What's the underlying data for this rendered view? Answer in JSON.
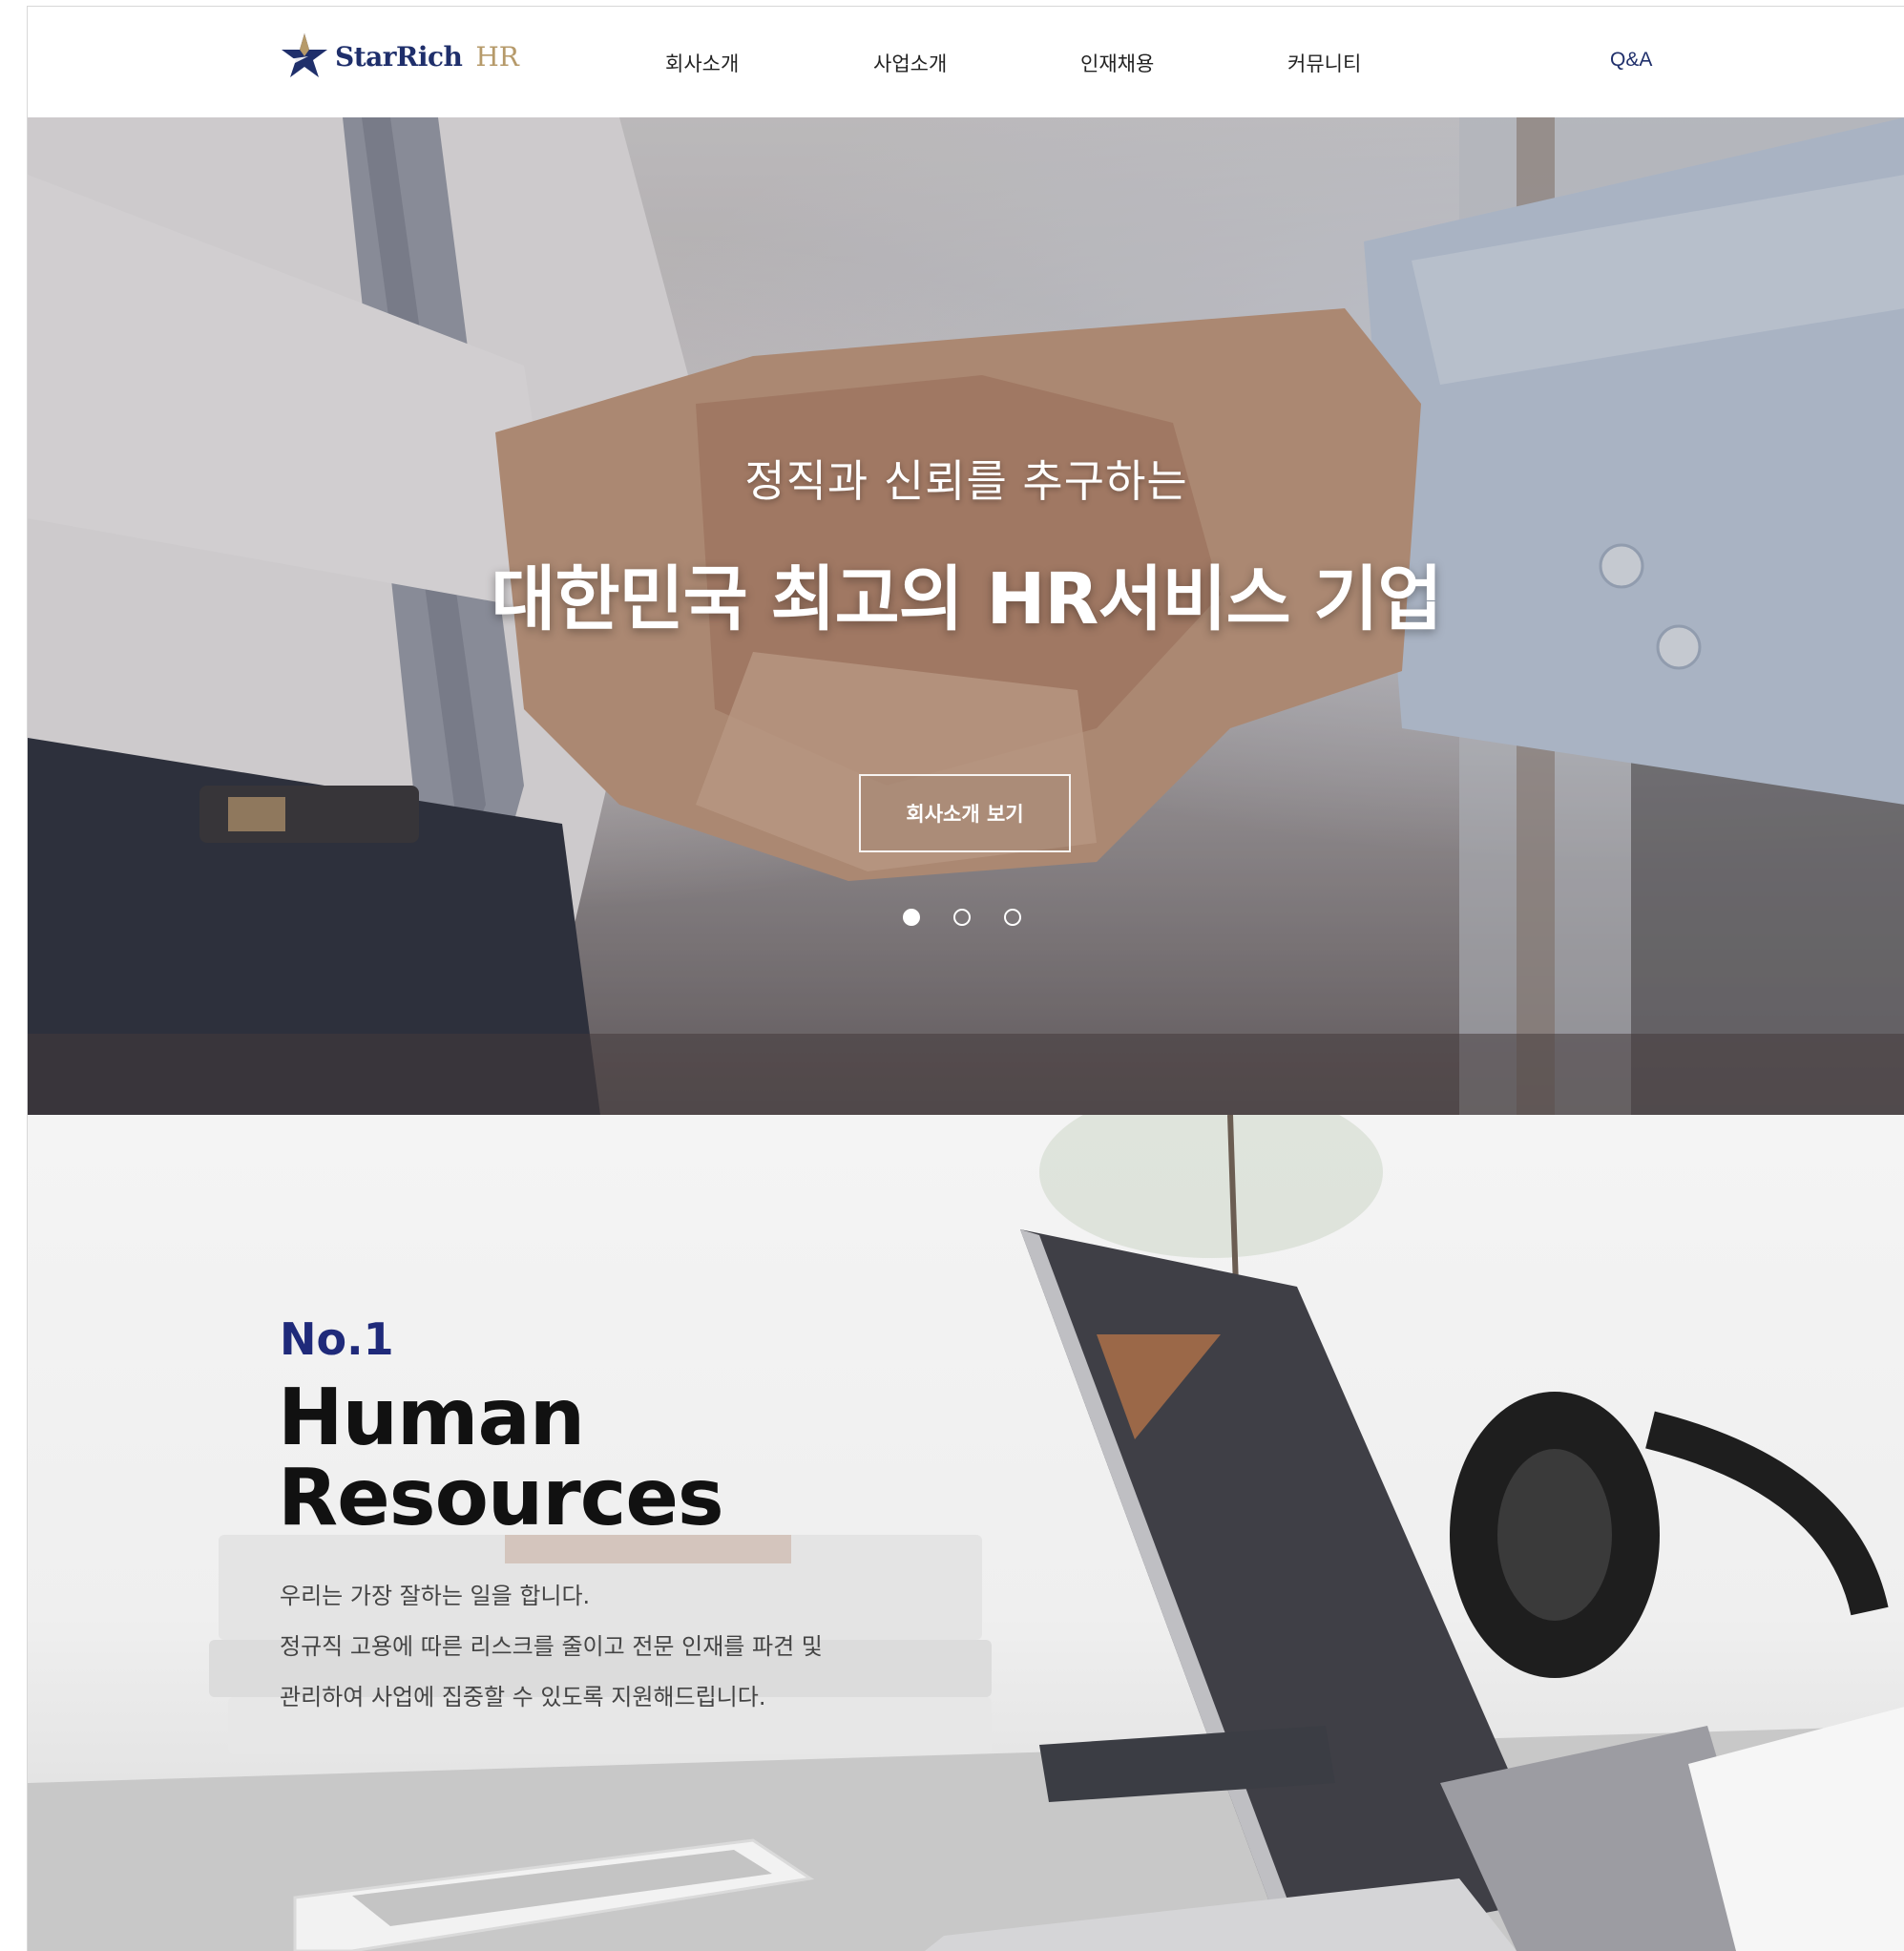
{
  "header": {
    "logo_text": "StarRich",
    "logo_suffix": "HR",
    "nav": [
      "회사소개",
      "사업소개",
      "인재채용",
      "커뮤니티"
    ],
    "qa_label": "Q&A"
  },
  "hero": {
    "subtitle": "정직과 신뢰를 추구하는",
    "title": "대한민국 최고의 HR서비스 기업",
    "button_label": "회사소개 보기",
    "slide_count": 3,
    "active_slide": 1
  },
  "section2": {
    "badge": "No.1",
    "title_line1": "Human",
    "title_line2": "Resources",
    "desc_lines": [
      "우리는 가장 잘하는 일을 합니다.",
      "정규직 고용에 따른 리스크를 줄이고 전문 인재를 파견 및",
      "관리하여 사업에 집중할 수 있도록 지원해드립니다."
    ]
  },
  "colors": {
    "brand_navy": "#1f2f6b",
    "brand_gold": "#b69a6a",
    "accent_blue": "#1f2a7a"
  }
}
